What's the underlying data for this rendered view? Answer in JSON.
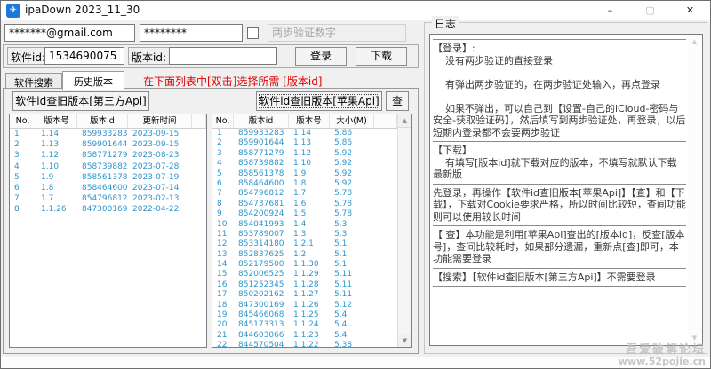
{
  "window": {
    "title": "ipaDown 2023_11_30"
  },
  "icons": {
    "app": "✈",
    "minimize": "–",
    "maximize": "▢",
    "close": "✕",
    "scroll_up": "▲",
    "scroll_down": "▼"
  },
  "login": {
    "email_value": "*******@gmail.com",
    "password_value": "********",
    "twofa_placeholder": "两步验证数字",
    "software_id_label": "软件id:",
    "software_id_value": "1534690075",
    "version_id_label": "版本id:",
    "version_id_value": "",
    "login_button": "登录",
    "download_button": "下载"
  },
  "tabs": {
    "search_tab": "软件搜索",
    "history_tab": "历史版本",
    "hint": "在下面列表中[双击]选择所需 [版本id]"
  },
  "actions": {
    "third_party_button": "软件id查旧版本[第三方Api]",
    "apple_api_button": "软件id查旧版本[苹果Api]",
    "query_button": "查"
  },
  "left_table": {
    "headers": [
      "No.",
      "版本号",
      "版本id",
      "更新时间"
    ],
    "rows": [
      [
        "1",
        "1.14",
        "859933283",
        "2023-09-15"
      ],
      [
        "2",
        "1.13",
        "859901644",
        "2023-09-15"
      ],
      [
        "3",
        "1.12",
        "858771279",
        "2023-08-23"
      ],
      [
        "4",
        "1.10",
        "858739882",
        "2023-07-28"
      ],
      [
        "5",
        "1.9",
        "858561378",
        "2023-07-19"
      ],
      [
        "6",
        "1.8",
        "858464600",
        "2023-07-14"
      ],
      [
        "7",
        "1.7",
        "854796812",
        "2023-02-13"
      ],
      [
        "8",
        "1.1.26",
        "847300169",
        "2022-04-22"
      ]
    ]
  },
  "right_table": {
    "headers": [
      "No.",
      "版本id",
      "版本号",
      "大小(M)"
    ],
    "rows": [
      [
        "1",
        "859933283",
        "1.14",
        "5.86"
      ],
      [
        "2",
        "859901644",
        "1.13",
        "5.86"
      ],
      [
        "3",
        "858771279",
        "1.12",
        "5.92"
      ],
      [
        "4",
        "858739882",
        "1.10",
        "5.92"
      ],
      [
        "5",
        "858561378",
        "1.9",
        "5.92"
      ],
      [
        "6",
        "858464600",
        "1.8",
        "5.92"
      ],
      [
        "7",
        "854796812",
        "1.7",
        "5.78"
      ],
      [
        "8",
        "854737681",
        "1.6",
        "5.78"
      ],
      [
        "9",
        "854200924",
        "1.5",
        "5.78"
      ],
      [
        "10",
        "854041993",
        "1.4",
        "5.3"
      ],
      [
        "11",
        "853789007",
        "1.3",
        "5.3"
      ],
      [
        "12",
        "853314180",
        "1.2.1",
        "5.1"
      ],
      [
        "13",
        "852837625",
        "1.2",
        "5.1"
      ],
      [
        "14",
        "852179500",
        "1.1.30",
        "5.1"
      ],
      [
        "15",
        "852006525",
        "1.1.29",
        "5.11"
      ],
      [
        "16",
        "851252345",
        "1.1.28",
        "5.11"
      ],
      [
        "17",
        "850202162",
        "1.1.27",
        "5.11"
      ],
      [
        "18",
        "847300169",
        "1.1.26",
        "5.12"
      ],
      [
        "19",
        "845466068",
        "1.1.25",
        "5.4"
      ],
      [
        "20",
        "845173313",
        "1.1.24",
        "5.4"
      ],
      [
        "21",
        "844603066",
        "1.1.23",
        "5.4"
      ],
      [
        "22",
        "844570504",
        "1.1.22",
        "5.38"
      ]
    ]
  },
  "log": {
    "group_label": "日志",
    "entries": [
      {
        "type": "sep"
      },
      {
        "type": "text",
        "text": "【登录】:"
      },
      {
        "type": "text",
        "text": "    没有两步验证的直接登录"
      },
      {
        "type": "text",
        "text": ""
      },
      {
        "type": "text",
        "text": "    有弹出两步验证的，在两步验证处输入，再点登录"
      },
      {
        "type": "text",
        "text": ""
      },
      {
        "type": "text",
        "text": "    如果不弹出，可以自己到【设置-自己的iCloud-密码与安全-获取验证码】，然后填写到两步验证处，再登录，以后短期内登录都不会要两步验证"
      },
      {
        "type": "sep"
      },
      {
        "type": "text",
        "text": "【下载】"
      },
      {
        "type": "text",
        "text": "    有填写[版本id]就下载对应的版本，不填写就默认下载最新版"
      },
      {
        "type": "sep"
      },
      {
        "type": "text",
        "text": "先登录，再操作【软件id查旧版本[苹果Api]】【查】和【下载】，下载对Cookie要求严格，所以时间比较短，查间功能则可以使用较长时间"
      },
      {
        "type": "sep"
      },
      {
        "type": "text",
        "text": "【 查】本功能是利用[苹果Api]查出的[版本id]，反查[版本号]，查间比较耗时，如果部分遗漏，重新点[查]即可，本功能需要登录"
      },
      {
        "type": "sep"
      },
      {
        "type": "text",
        "text": "【搜索】【软件id查旧版本[第三方Api]】不需要登录"
      },
      {
        "type": "sep"
      }
    ]
  },
  "watermark": {
    "line1": "吾爱破解论坛",
    "line2": "www.52pojie.cn"
  },
  "colors": {
    "table_text": "#2e96cc",
    "hint_red": "#dd0000",
    "icon_blue": "#1e78d7"
  }
}
